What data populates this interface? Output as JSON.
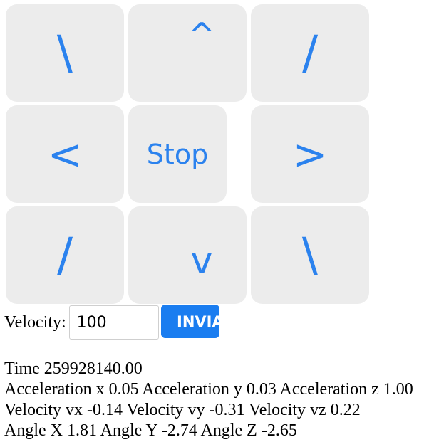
{
  "controls": {
    "up_left": "\\",
    "up": "^",
    "up_right": "/",
    "left": "<",
    "stop": "Stop",
    "right": ">",
    "down_left": "/",
    "down": "v",
    "down_right": "\\"
  },
  "velocity": {
    "label": "Velocity:",
    "value": "100",
    "send_label": "INVIA"
  },
  "readout": {
    "time": "Time 259928140.00",
    "acceleration": "Acceleration x 0.05 Acceleration y 0.03 Acceleration z 1.00",
    "velocity": "Velocity vx -0.14 Velocity vy -0.31 Velocity vz 0.22",
    "angle": "Angle X 1.81 Angle Y -2.74 Angle Z -2.65"
  },
  "colors": {
    "accent": "#2b82ee",
    "button_bg": "#ececec",
    "send_button": "#1a7df0"
  }
}
